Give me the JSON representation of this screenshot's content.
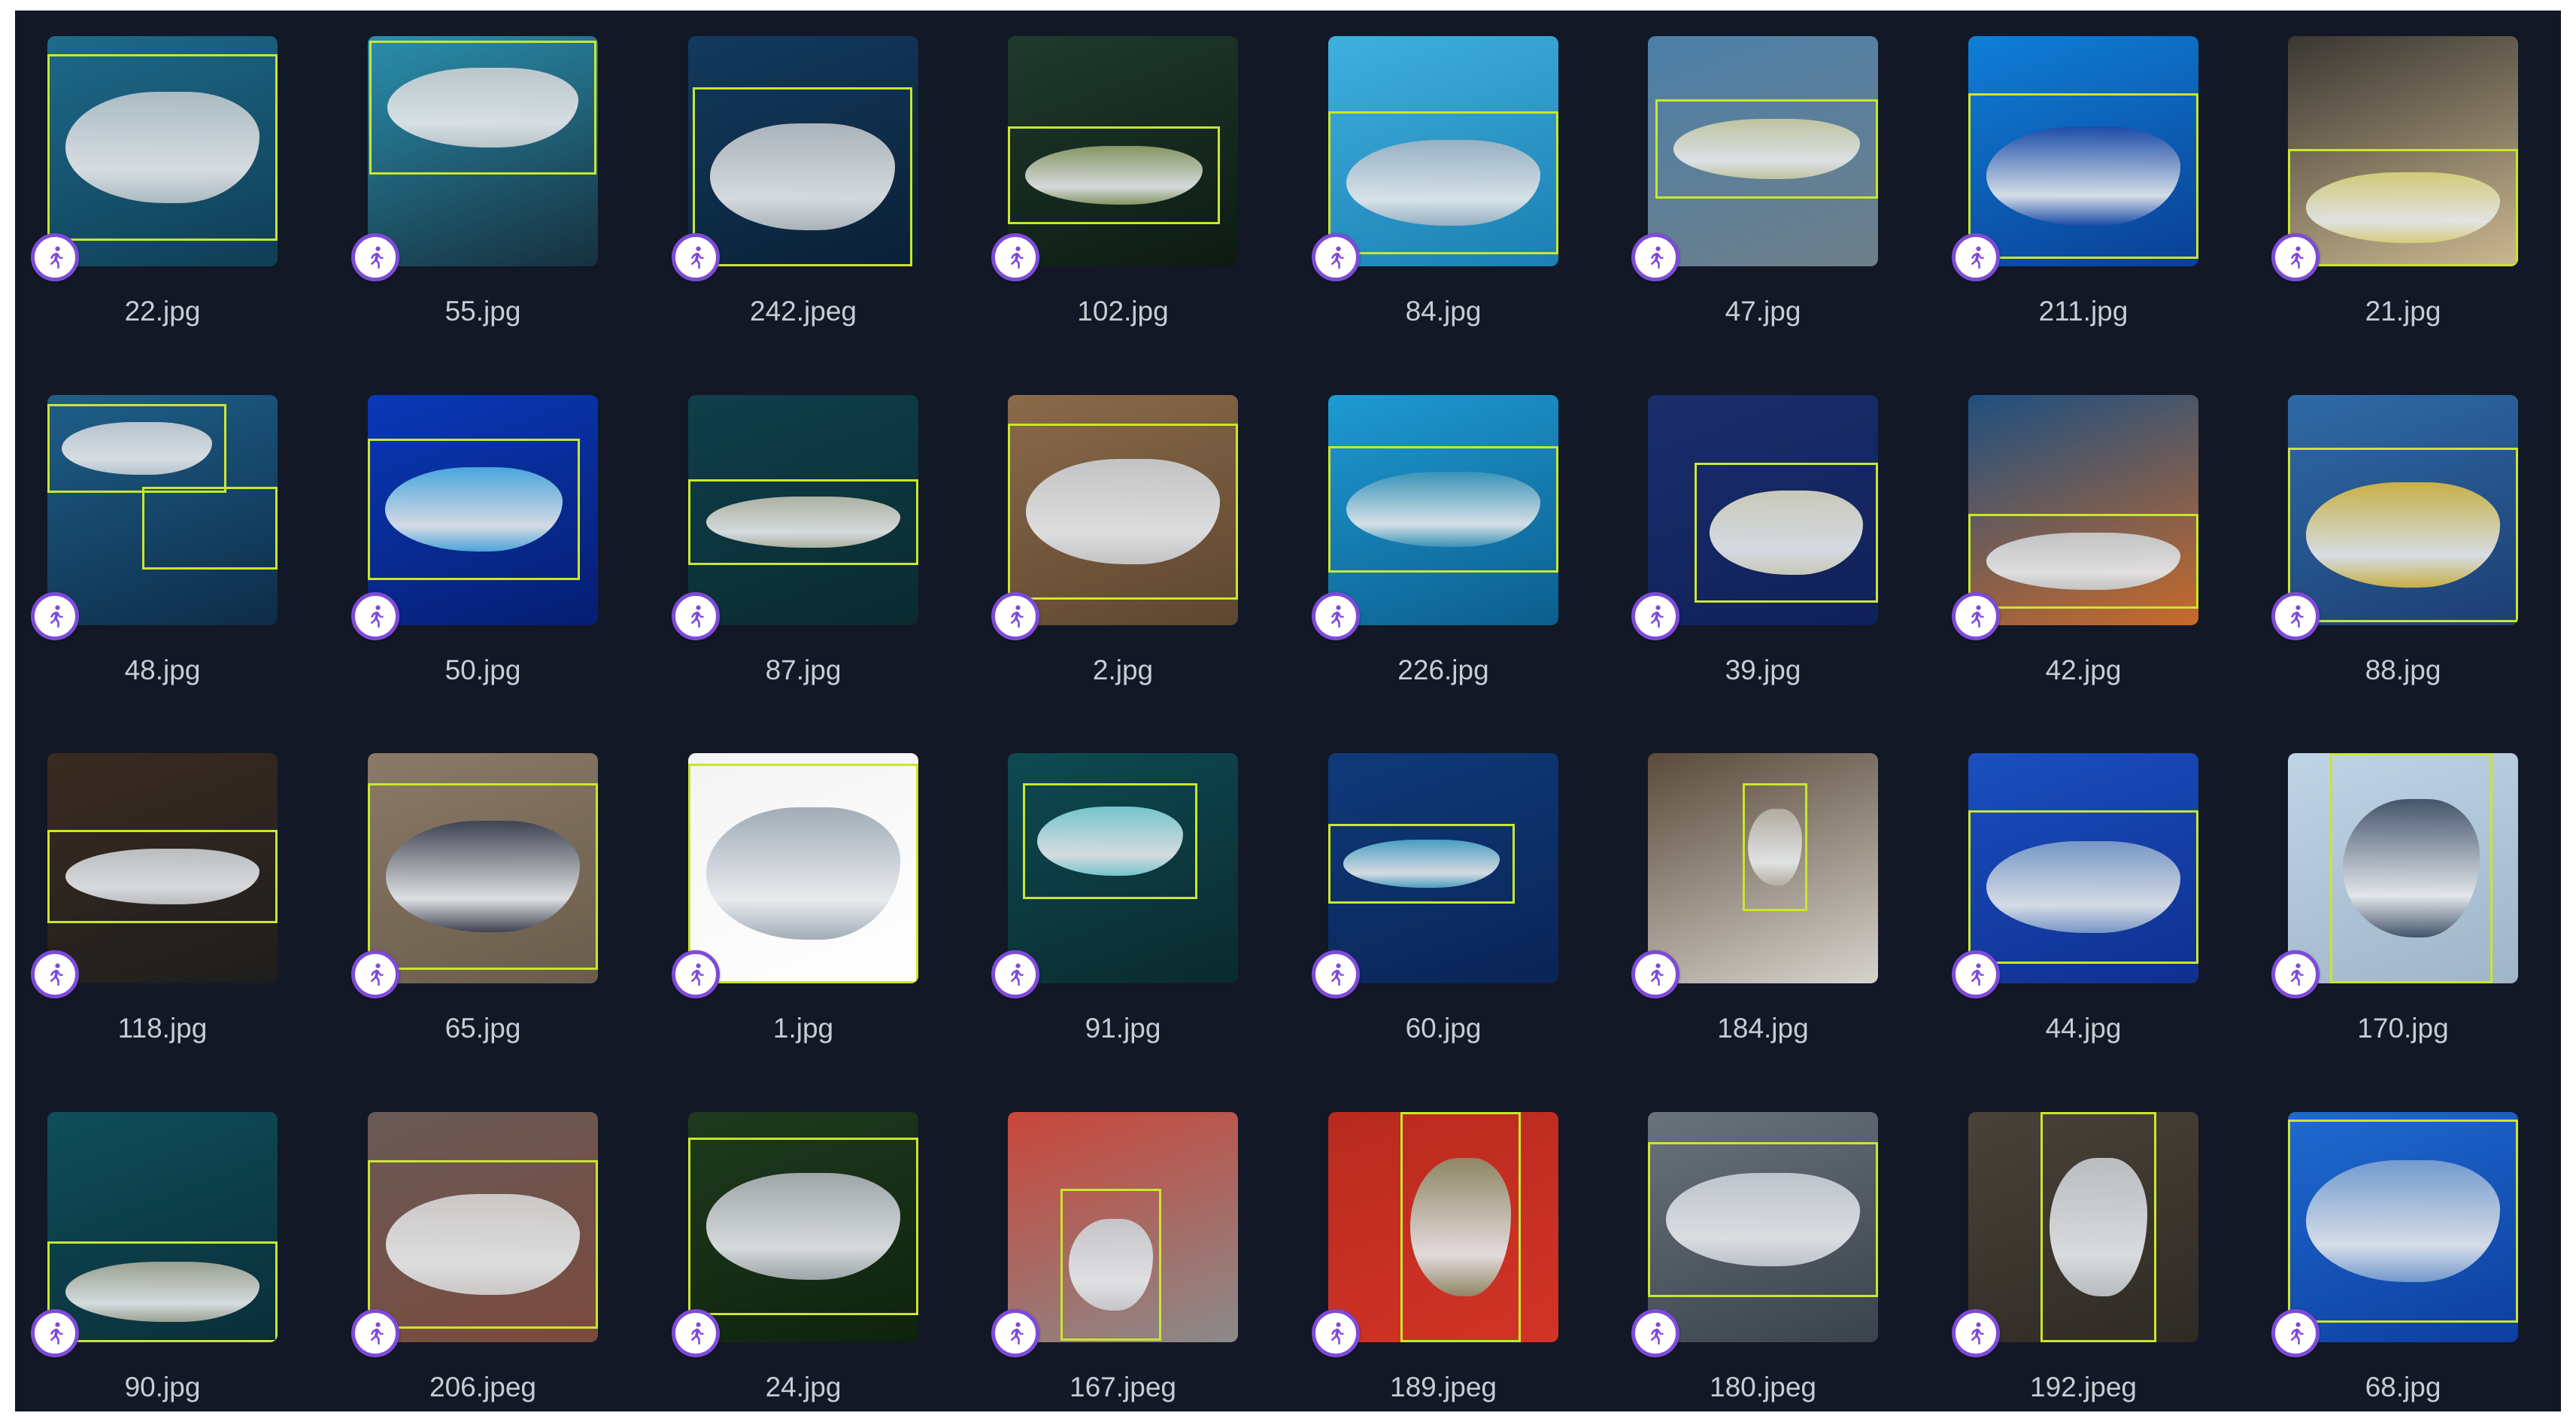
{
  "accent_color": "#7e4ad8",
  "bbox_color": "#c9e62e",
  "badge_icon": "person-running-icon",
  "images": [
    {
      "filename": "22.jpg",
      "bg": [
        "#1e6a8a",
        "#0f3d55"
      ],
      "fish": "#b8c3c9"
    },
    {
      "filename": "55.jpg",
      "bg": [
        "#2a8fae",
        "#16303e"
      ],
      "fish": "#c6ced0"
    },
    {
      "filename": "242.jpeg",
      "bg": [
        "#123a5e",
        "#0a2036"
      ],
      "fish": "#b7bec4"
    },
    {
      "filename": "102.jpg",
      "bg": [
        "#1f3a2c",
        "#0d1a14"
      ],
      "fish": "#8fa06a"
    },
    {
      "filename": "84.jpg",
      "bg": [
        "#3fb0de",
        "#1b7fb3"
      ],
      "fish": "#9fb3c2"
    },
    {
      "filename": "47.jpg",
      "bg": [
        "#4c7fa9",
        "#6e7f89"
      ],
      "fish": "#c7c9a0"
    },
    {
      "filename": "211.jpg",
      "bg": [
        "#0f7fd6",
        "#0a3f96"
      ],
      "fish": "#1c4aa6"
    },
    {
      "filename": "21.jpg",
      "bg": [
        "#3a3632",
        "#cbb890"
      ],
      "fish": "#d8d07a"
    },
    {
      "filename": "48.jpg",
      "bg": [
        "#1f5f8a",
        "#0d2c48"
      ],
      "fish": "#c4ccd2"
    },
    {
      "filename": "50.jpg",
      "bg": [
        "#0a38b8",
        "#061e72"
      ],
      "fish": "#4fb0e2"
    },
    {
      "filename": "87.jpg",
      "bg": [
        "#0f3f4a",
        "#0a2a30"
      ],
      "fish": "#b9bcaa"
    },
    {
      "filename": "2.jpg",
      "bg": [
        "#8a6a4a",
        "#5e4630"
      ],
      "fish": "#c9ccd0"
    },
    {
      "filename": "226.jpg",
      "bg": [
        "#1e9ad2",
        "#0c5e8e"
      ],
      "fish": "#3c95b8"
    },
    {
      "filename": "39.jpg",
      "bg": [
        "#1a2e6a",
        "#10205a"
      ],
      "fish": "#d8d6c0"
    },
    {
      "filename": "42.jpg",
      "bg": [
        "#1e4f80",
        "#c96a2a"
      ],
      "fish": "#c8ccce"
    },
    {
      "filename": "88.jpg",
      "bg": [
        "#2f6aa6",
        "#1d3f74"
      ],
      "fish": "#d6b840"
    },
    {
      "filename": "118.jpg",
      "bg": [
        "#3a2a20",
        "#1e1e1e"
      ],
      "fish": "#c6c9cc"
    },
    {
      "filename": "65.jpg",
      "bg": [
        "#8a7a66",
        "#6a5c4c"
      ],
      "fish": "#3a4052"
    },
    {
      "filename": "1.jpg",
      "bg": [
        "#f4f4f4",
        "#ffffff"
      ],
      "fish": "#9aa6b2"
    },
    {
      "filename": "91.jpg",
      "bg": [
        "#0e4a52",
        "#0a2a2e"
      ],
      "fish": "#7fd0d8"
    },
    {
      "filename": "60.jpg",
      "bg": [
        "#0f3a7a",
        "#0a2456"
      ],
      "fish": "#4fa8c8"
    },
    {
      "filename": "184.jpg",
      "bg": [
        "#5a4a3a",
        "#d6d2cc"
      ],
      "fish": "#b6b0a4"
    },
    {
      "filename": "44.jpg",
      "bg": [
        "#1a4fc0",
        "#0f2f90"
      ],
      "fish": "#7f9ec8"
    },
    {
      "filename": "170.jpg",
      "bg": [
        "#bfd4e6",
        "#9fb6c8"
      ],
      "fish": "#3a4a62"
    },
    {
      "filename": "90.jpg",
      "bg": [
        "#0e4e5a",
        "#0a2e38"
      ],
      "fish": "#a6aa98"
    },
    {
      "filename": "206.jpeg",
      "bg": [
        "#6a5a56",
        "#7a4a3e"
      ],
      "fish": "#d2d2d0"
    },
    {
      "filename": "24.jpg",
      "bg": [
        "#1e3a1e",
        "#0e220e"
      ],
      "fish": "#aab0b4"
    },
    {
      "filename": "167.jpeg",
      "bg": [
        "#c9463a",
        "#8a8a8a"
      ],
      "fish": "#c8ccd0"
    },
    {
      "filename": "189.jpeg",
      "bg": [
        "#b82a1e",
        "#d23426"
      ],
      "fish": "#8a8e6a"
    },
    {
      "filename": "180.jpeg",
      "bg": [
        "#6a727c",
        "#3a424c"
      ],
      "fish": "#c6ccd4"
    },
    {
      "filename": "192.jpeg",
      "bg": [
        "#4a4238",
        "#2e2a24"
      ],
      "fish": "#c4c8cc"
    },
    {
      "filename": "68.jpg",
      "bg": [
        "#1e6ad0",
        "#0e3ea0"
      ],
      "fish": "#7aa0d0"
    }
  ]
}
